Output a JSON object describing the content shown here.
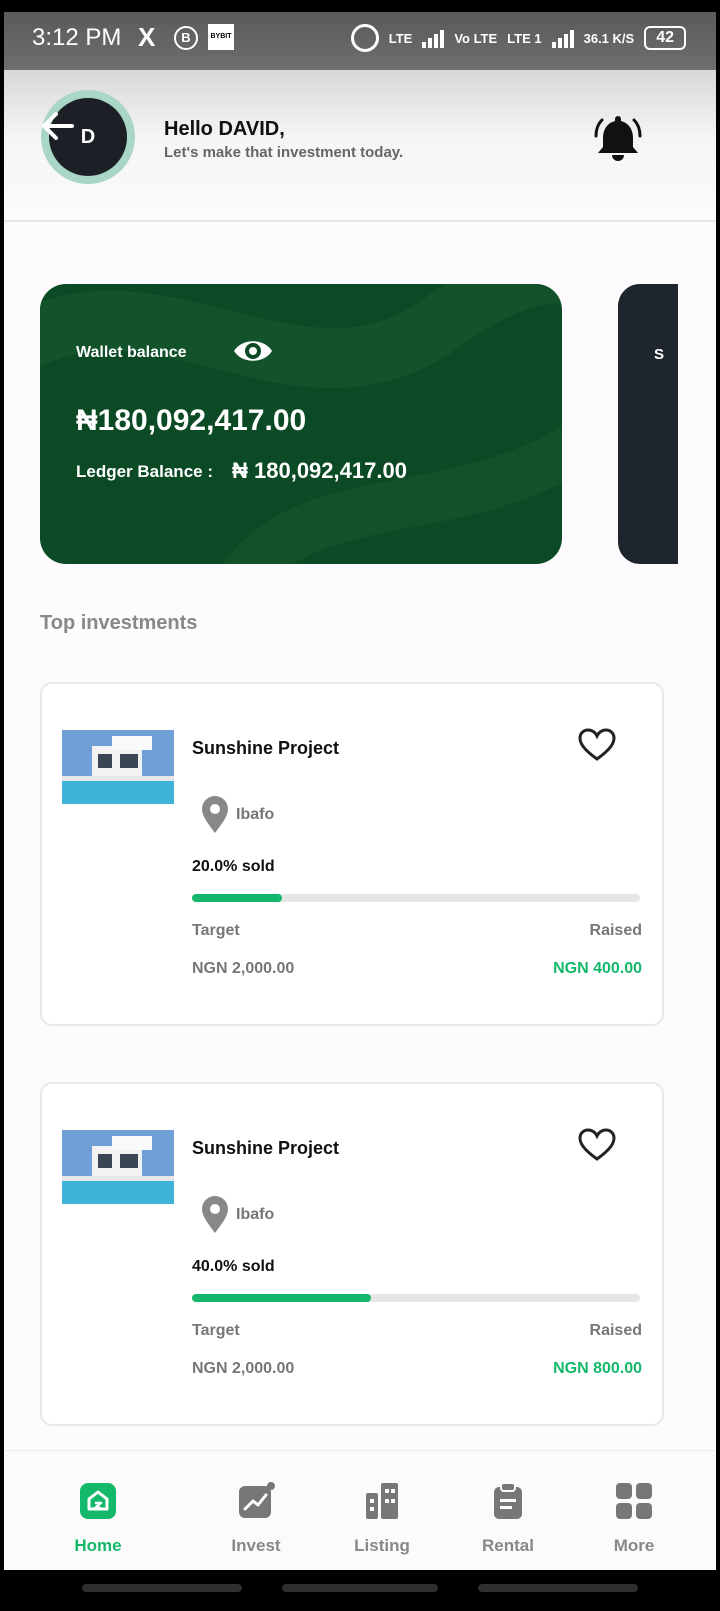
{
  "status_bar": {
    "time": "3:12 PM",
    "x_label": "X",
    "b_label": "B",
    "bybit_label": "BYBIT",
    "lte1": "LTE",
    "volte": "Vo LTE",
    "lte2": "LTE 1",
    "speed": "36.1 K/S",
    "battery": "42"
  },
  "header": {
    "avatar_initial": "D",
    "greeting": "Hello DAVID,",
    "subtitle": "Let's make that investment today."
  },
  "wallet": {
    "label": "Wallet balance",
    "balance": "₦180,092,417.00",
    "ledger_label": "Ledger Balance :",
    "ledger_value": "₦ 180,092,417.00",
    "bg_color": "#0b4a24"
  },
  "second_card": {
    "label_fragment": "S"
  },
  "section": {
    "title": "Top investments"
  },
  "investments": [
    {
      "title": "Sunshine Project",
      "location": "Ibafo",
      "sold_label": "20.0% sold",
      "sold_fraction": 0.2,
      "target_label": "Target",
      "raised_label": "Raised",
      "target_value": "NGN 2,000.00",
      "raised_value": "NGN 400.00"
    },
    {
      "title": "Sunshine Project",
      "location": "Ibafo",
      "sold_label": "40.0% sold",
      "sold_fraction": 0.4,
      "target_label": "Target",
      "raised_label": "Raised",
      "target_value": "NGN 2,000.00",
      "raised_value": "NGN 800.00"
    }
  ],
  "nav": {
    "items": [
      {
        "label": "Home",
        "icon": "home-icon",
        "active": true
      },
      {
        "label": "Invest",
        "icon": "invest-chart-icon",
        "active": false
      },
      {
        "label": "Listing",
        "icon": "listing-buildings-icon",
        "active": false
      },
      {
        "label": "Rental",
        "icon": "rental-clipboard-icon",
        "active": false
      },
      {
        "label": "More",
        "icon": "more-grid-icon",
        "active": false
      }
    ]
  },
  "colors": {
    "accent": "#14b86a",
    "wallet_green": "#0b4a24",
    "dark_card": "#1e252c"
  }
}
